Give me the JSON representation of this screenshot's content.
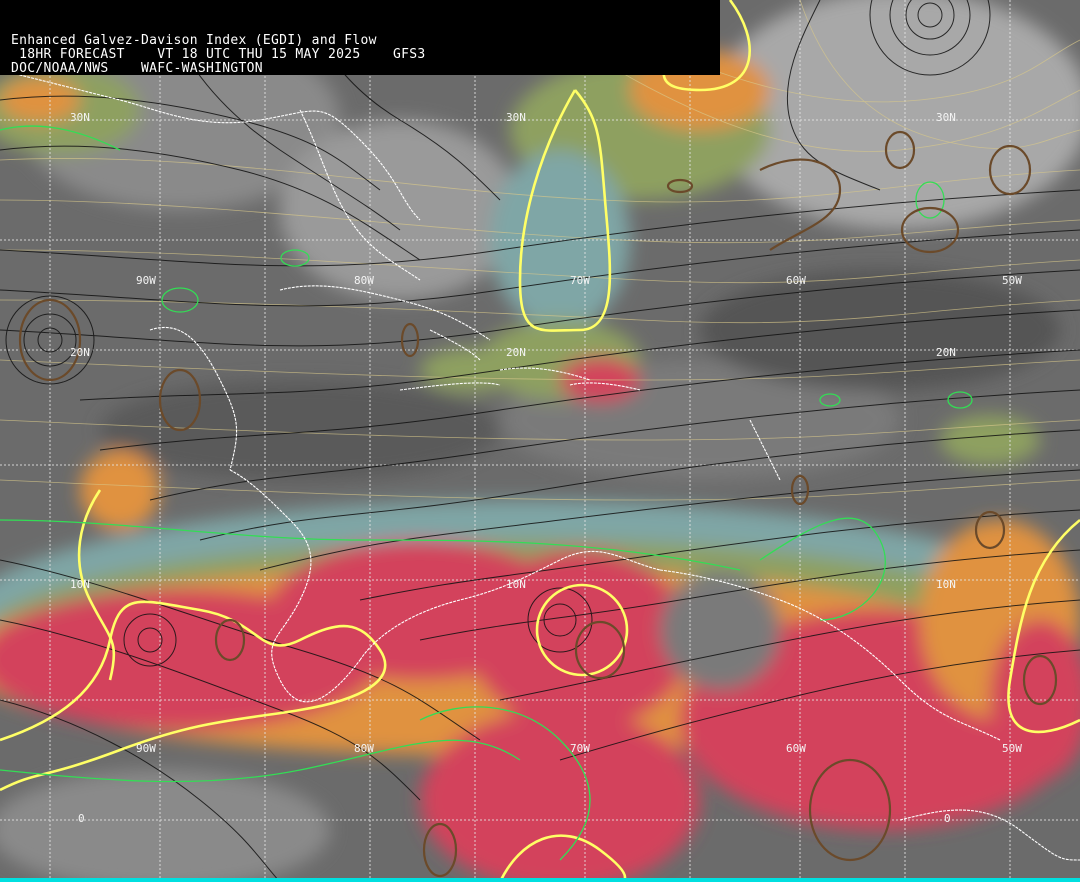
{
  "header": {
    "line1": "Enhanced Galvez-Davison Index (EGDI) and Flow",
    "line2": " 18HR FORECAST    VT 18 UTC THU 15 MAY 2025    GFS3",
    "line3": "DOC/NOAA/NWS    WAFC-WASHINGTON"
  },
  "lat_labels": [
    "30N",
    "30N",
    "30N",
    "20N",
    "20N",
    "20N",
    "10N",
    "10N",
    "10N",
    "0",
    "0"
  ],
  "lon_labels": [
    "90W",
    "80W",
    "70W",
    "60W",
    "50W",
    "90W",
    "80W",
    "70W",
    "60W",
    "50W"
  ],
  "colors": {
    "dry_gray": "#5a5a5a",
    "mid_gray": "#8a8a8a",
    "teal": "#7fa6a6",
    "olive": "#8ea060",
    "orange": "#e0923f",
    "red": "#d3425c",
    "yellow_contour": "#ffff66",
    "green_contour": "#33dd55",
    "brown_contour": "#6b4a2a",
    "streamline": "#111111",
    "coastline": "#ffffff",
    "grid": "#e6e6e6",
    "bottom_bar": "#00e0e0"
  }
}
